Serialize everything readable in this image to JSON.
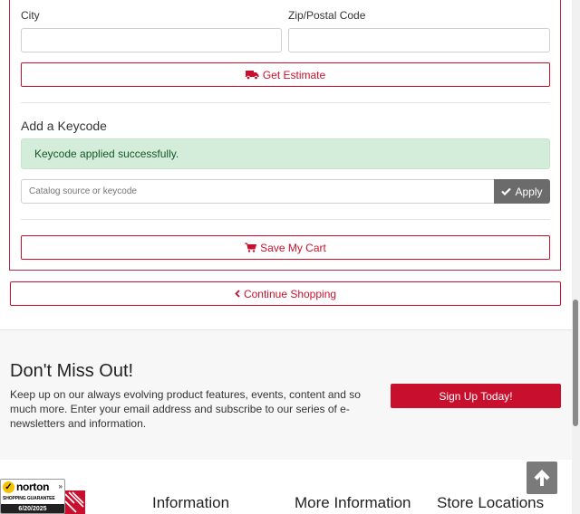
{
  "shipping": {
    "city_label": "City",
    "city_value": "",
    "zip_label": "Zip/Postal Code",
    "zip_value": "",
    "get_estimate_label": "Get Estimate"
  },
  "keycode": {
    "title": "Add a Keycode",
    "success_message": "Keycode applied successfully.",
    "input_placeholder": "Catalog source or keycode",
    "apply_label": "Apply"
  },
  "cart": {
    "save_label": "Save My Cart",
    "continue_label": "Continue Shopping"
  },
  "newsletter": {
    "title": "Don't Miss Out!",
    "text": "Keep up on our always evolving product features, events, content and so much more. Enter your email address and subscribe to our series of e-newsletters and information.",
    "signup_label": "Sign Up Today!"
  },
  "footer": {
    "headings": [
      "Information",
      "More Information",
      "Store Locations"
    ]
  },
  "norton": {
    "brand": "norton",
    "subtitle": "SHOPPING GUARANTEE",
    "date": "6/20/2025"
  },
  "colors": {
    "accent": "#c8102e",
    "success_bg": "#d4edda",
    "success_text": "#155724"
  },
  "icons": {
    "truck": "truck-icon",
    "check": "check-icon",
    "cart": "shopping-cart-icon",
    "chevron_left": "chevron-left-icon",
    "arrow_up": "arrow-up-icon"
  }
}
